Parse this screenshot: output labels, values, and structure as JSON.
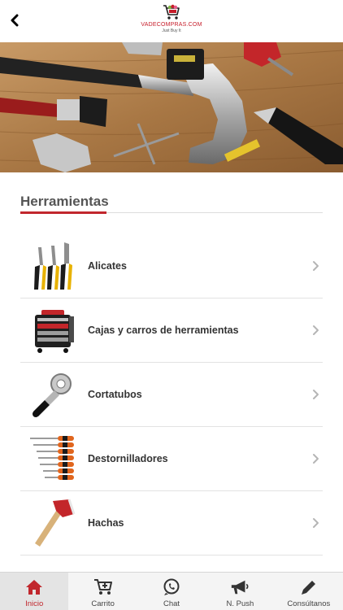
{
  "header": {
    "logo_name": "VADECOMPRAS.COM",
    "logo_tagline": "Just Buy It",
    "icons": {
      "back": "chevron-left-icon",
      "logo": "shopping-cart-logo"
    }
  },
  "hero": {
    "icon": "tools-banner-image"
  },
  "section": {
    "title": "Herramientas"
  },
  "categories": [
    {
      "label": "Alicates",
      "icon": "pliers-image"
    },
    {
      "label": "Cajas y carros de herramientas",
      "icon": "tool-cart-image"
    },
    {
      "label": "Cortatubos",
      "icon": "pipe-cutter-image"
    },
    {
      "label": "Destornilladores",
      "icon": "screwdrivers-image"
    },
    {
      "label": "Hachas",
      "icon": "axe-image"
    }
  ],
  "tabbar": {
    "tabs": [
      {
        "label": "Inicio",
        "icon": "home-icon",
        "active": true
      },
      {
        "label": "Carrito",
        "icon": "cart-add-icon",
        "active": false
      },
      {
        "label": "Chat",
        "icon": "whatsapp-icon",
        "active": false
      },
      {
        "label": "N. Push",
        "icon": "megaphone-icon",
        "active": false
      },
      {
        "label": "Consúltanos",
        "icon": "pencil-icon",
        "active": false
      }
    ]
  },
  "colors": {
    "accent": "#c1272d",
    "logo_red": "#c61d2a",
    "tabbar_bg": "#f4f4f4",
    "text": "#333333"
  }
}
